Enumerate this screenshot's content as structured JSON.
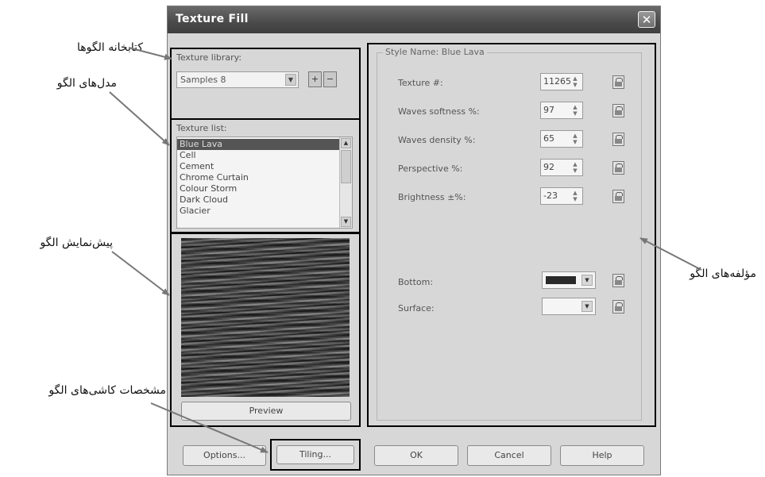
{
  "annotations": {
    "texture_library": "کتابخانه الگوها",
    "texture_list": "مدل‌های الگو",
    "texture_preview": "پیش‌نمایش الگو",
    "tiling": "مشخصات کاشی‌های الگو",
    "texture_params": "مؤلفه‌های  الگو"
  },
  "dialog": {
    "title": "Texture Fill",
    "close_icon": "close-icon",
    "library": {
      "label": "Texture library:",
      "selected": "Samples 8",
      "add_icon": "plus-icon",
      "remove_icon": "minus-icon"
    },
    "texture_list": {
      "label": "Texture list:",
      "items": [
        "Blue Lava",
        "Cell",
        "Cement",
        "Chrome Curtain",
        "Colour Storm",
        "Dark Cloud",
        "Glacier"
      ],
      "selected": "Blue Lava"
    },
    "preview_button": "Preview",
    "style": {
      "group_title": "Style Name: Blue Lava",
      "params": [
        {
          "label": "Texture #:",
          "value": "11265"
        },
        {
          "label": "Waves softness %:",
          "value": "97"
        },
        {
          "label": "Waves density %:",
          "value": "65"
        },
        {
          "label": "Perspective %:",
          "value": "92"
        },
        {
          "label": "Brightness ±%:",
          "value": "-23"
        }
      ],
      "colors": [
        {
          "label": "Bottom:",
          "color": "#2a2a2a"
        },
        {
          "label": "Surface:",
          "color": "#f5f5f5"
        }
      ]
    },
    "buttons": {
      "options": "Options...",
      "tiling": "Tiling...",
      "ok": "OK",
      "cancel": "Cancel",
      "help": "Help"
    }
  }
}
